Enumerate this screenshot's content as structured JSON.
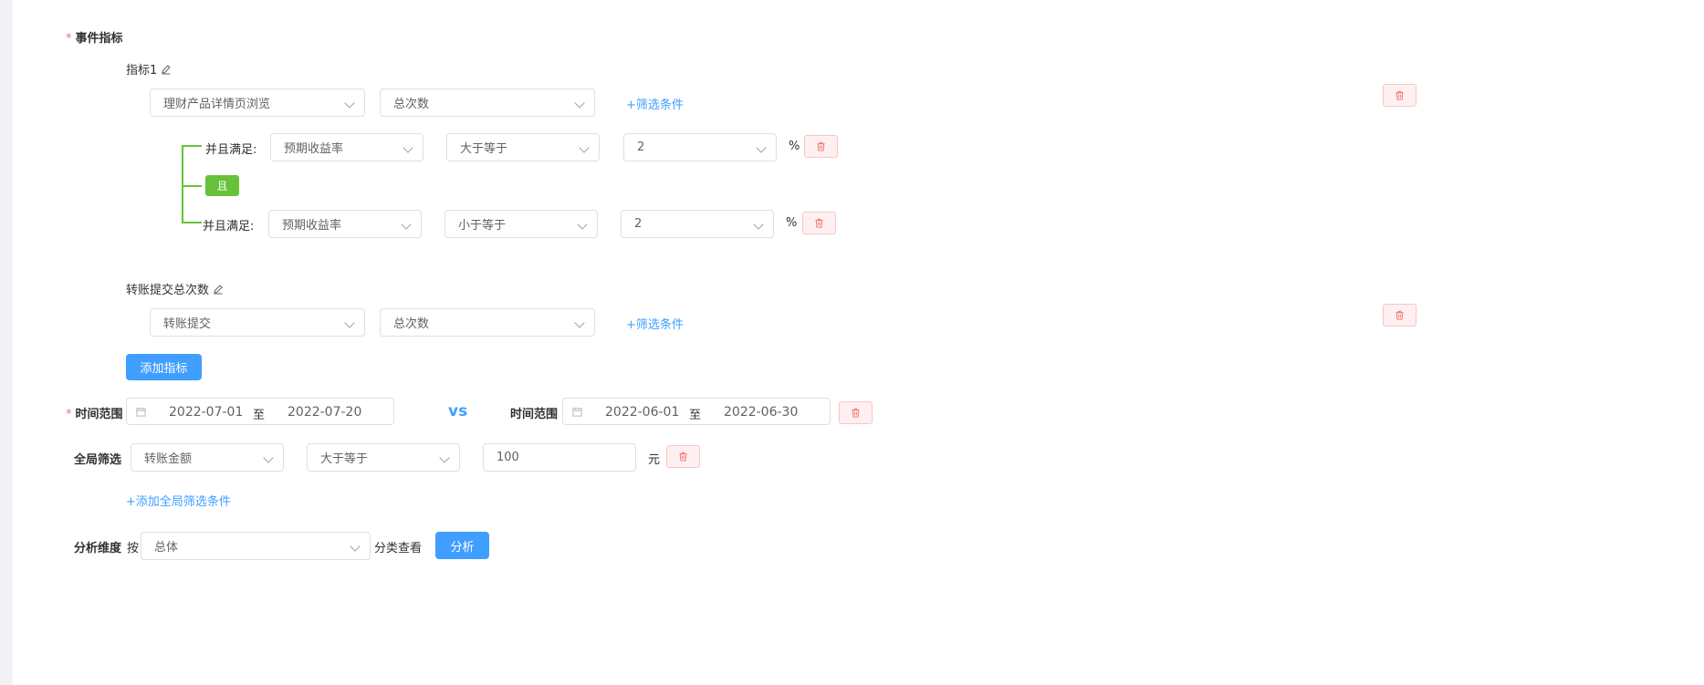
{
  "event_metrics": {
    "label": "事件指标",
    "required_mark": "*"
  },
  "metric1": {
    "name": "指标1",
    "event_select": "理财产品详情页浏览",
    "measure_select": "总次数",
    "add_filter_link": "+筛选条件",
    "filters": [
      {
        "prefix": "并且满足:",
        "field": "预期收益率",
        "operator": "大于等于",
        "value": "2",
        "unit": "%"
      },
      {
        "prefix": "并且满足:",
        "field": "预期收益率",
        "operator": "小于等于",
        "value": "2",
        "unit": "%"
      }
    ],
    "logic_tag": "且"
  },
  "metric2": {
    "name": "转账提交总次数",
    "event_select": "转账提交",
    "measure_select": "总次数",
    "add_filter_link": "+筛选条件"
  },
  "add_metric_button": "添加指标",
  "time_range": {
    "label": "时间范围",
    "required_mark": "*",
    "start": "2022-07-01",
    "separator": "至",
    "end": "2022-07-20",
    "vs": "vs",
    "compare_label": "时间范围",
    "compare_start": "2022-06-01",
    "compare_end": "2022-06-30"
  },
  "global_filter": {
    "label": "全局筛选",
    "field": "转账金额",
    "operator": "大于等于",
    "value": "100",
    "unit": "元",
    "add_link": "+添加全局筛选条件"
  },
  "dimension": {
    "label": "分析维度",
    "by": "按",
    "select": "总体",
    "suffix": "分类查看",
    "analyze_button": "分析"
  },
  "icons": {
    "delete": "trash-icon",
    "edit": "edit-icon",
    "calendar": "calendar-icon",
    "dropdown": "chevron-down-icon"
  },
  "colors": {
    "primary": "#409eff",
    "success": "#67c23a",
    "danger": "#f56c6c",
    "danger_bg": "#fef0f0"
  }
}
